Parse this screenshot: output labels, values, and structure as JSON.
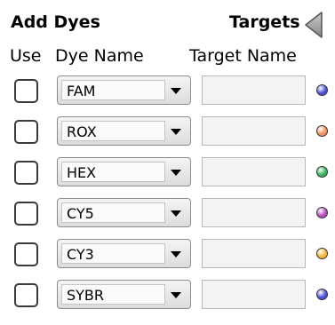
{
  "header": {
    "add_dyes": "Add Dyes",
    "targets": "Targets",
    "collapse_icon": "triangle-left-icon"
  },
  "columns": {
    "use": "Use",
    "dye_name": "Dye Name",
    "target_name": "Target Name"
  },
  "rows": [
    {
      "checked": false,
      "dye": "FAM",
      "target": "",
      "color": "#4a4fd6"
    },
    {
      "checked": false,
      "dye": "ROX",
      "target": "",
      "color": "#f0915f"
    },
    {
      "checked": false,
      "dye": "HEX",
      "target": "",
      "color": "#33b55a"
    },
    {
      "checked": false,
      "dye": "CY5",
      "target": "",
      "color": "#b84bbd"
    },
    {
      "checked": false,
      "dye": "CY3",
      "target": "",
      "color": "#f6b63a"
    },
    {
      "checked": false,
      "dye": "SYBR",
      "target": "",
      "color": "#4a4fd6"
    }
  ]
}
